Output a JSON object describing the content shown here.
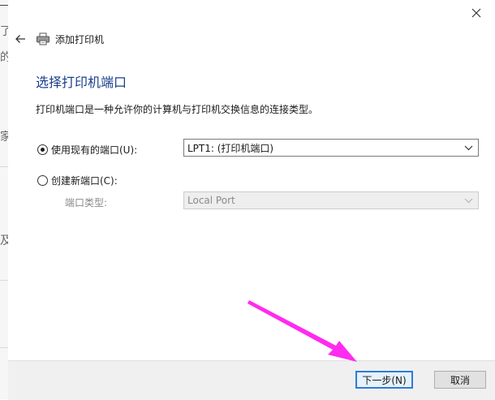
{
  "dialog": {
    "header_title": "添加打印机",
    "heading": "选择打印机端口",
    "description": "打印机端口是一种允许你的计算机与打印机交换信息的连接类型。"
  },
  "options": {
    "existing": {
      "label": "使用现有的端口(U):",
      "selected": true,
      "value": "LPT1: (打印机端口)"
    },
    "new": {
      "label": "创建新端口(C):",
      "selected": false,
      "type_label": "端口类型:",
      "type_value": "Local Port"
    }
  },
  "buttons": {
    "next": "下一步(N)",
    "cancel": "取消"
  },
  "background": {
    "glyphs": [
      "了",
      "的",
      "家",
      "及"
    ]
  },
  "icons": {
    "close": "close-icon",
    "back": "back-arrow-icon",
    "printer": "printer-icon",
    "dropdown": "chevron-down-icon"
  },
  "colors": {
    "accent": "#1a3e8c",
    "primary_border": "#2f7bd6",
    "annotation_arrow": "#ff2bf0"
  }
}
